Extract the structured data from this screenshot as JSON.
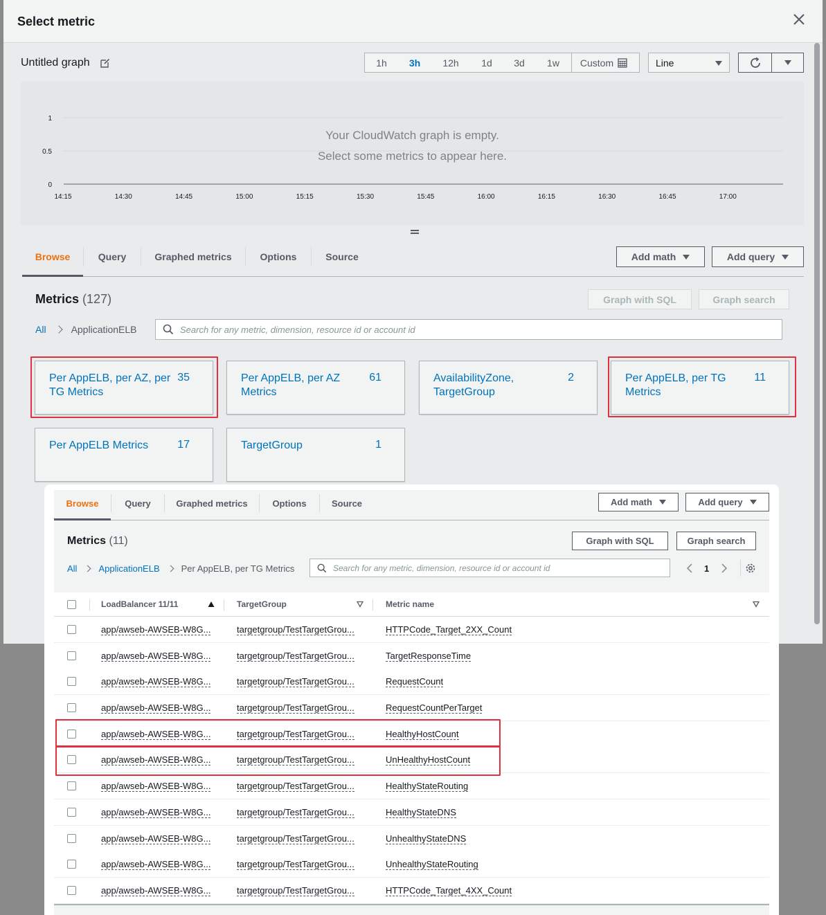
{
  "modal": {
    "title": "Select metric",
    "graph_title": "Untitled graph",
    "time_ranges": [
      "1h",
      "3h",
      "12h",
      "1d",
      "3d",
      "1w"
    ],
    "active_range": "3h",
    "custom_label": "Custom",
    "graph_type": "Line",
    "empty_line1": "Your CloudWatch graph is empty.",
    "empty_line2": "Select some metrics to appear here.",
    "y_ticks": [
      "1",
      "0.5",
      "0"
    ],
    "x_ticks": [
      "14:15",
      "14:30",
      "14:45",
      "15:00",
      "15:15",
      "15:30",
      "15:45",
      "16:00",
      "16:15",
      "16:30",
      "16:45",
      "17:00"
    ]
  },
  "tabs": [
    "Browse",
    "Query",
    "Graphed metrics",
    "Options",
    "Source"
  ],
  "buttons": {
    "add_math": "Add math",
    "add_query": "Add query",
    "graph_sql": "Graph with SQL",
    "graph_search": "Graph search"
  },
  "browse": {
    "heading": "Metrics",
    "count": "(127)",
    "crumb_all": "All",
    "crumb_current": "ApplicationELB",
    "search_placeholder": "Search for any metric, dimension, resource id or account id",
    "cards": [
      {
        "name": "Per AppELB, per AZ, per TG Metrics",
        "count": "35",
        "highlighted": true
      },
      {
        "name": "Per AppELB, per AZ Metrics",
        "count": "61",
        "highlighted": false
      },
      {
        "name": "AvailabilityZone, TargetGroup",
        "count": "2",
        "highlighted": false
      },
      {
        "name": "Per AppELB, per TG Metrics",
        "count": "11",
        "highlighted": true
      },
      {
        "name": "Per AppELB Metrics",
        "count": "17",
        "highlighted": false
      },
      {
        "name": "TargetGroup",
        "count": "1",
        "highlighted": false
      }
    ]
  },
  "detail": {
    "heading": "Metrics",
    "count": "(11)",
    "crumb_all": "All",
    "crumb_namespace": "ApplicationELB",
    "crumb_current": "Per AppELB, per TG Metrics",
    "search_placeholder": "Search for any metric, dimension, resource id or account id",
    "page": "1",
    "columns": [
      "LoadBalancer 11/11",
      "TargetGroup",
      "Metric name"
    ],
    "rows": [
      {
        "lb": "app/awseb-AWSEB-W8G...",
        "tg": "targetgroup/TestTargetGrou...",
        "metric": "HTTPCode_Target_2XX_Count"
      },
      {
        "lb": "app/awseb-AWSEB-W8G...",
        "tg": "targetgroup/TestTargetGrou...",
        "metric": "TargetResponseTime"
      },
      {
        "lb": "app/awseb-AWSEB-W8G...",
        "tg": "targetgroup/TestTargetGrou...",
        "metric": "RequestCount"
      },
      {
        "lb": "app/awseb-AWSEB-W8G...",
        "tg": "targetgroup/TestTargetGrou...",
        "metric": "RequestCountPerTarget"
      },
      {
        "lb": "app/awseb-AWSEB-W8G...",
        "tg": "targetgroup/TestTargetGrou...",
        "metric": "HealthyHostCount"
      },
      {
        "lb": "app/awseb-AWSEB-W8G...",
        "tg": "targetgroup/TestTargetGrou...",
        "metric": "UnHealthyHostCount"
      },
      {
        "lb": "app/awseb-AWSEB-W8G...",
        "tg": "targetgroup/TestTargetGrou...",
        "metric": "HealthyStateRouting"
      },
      {
        "lb": "app/awseb-AWSEB-W8G...",
        "tg": "targetgroup/TestTargetGrou...",
        "metric": "HealthyStateDNS"
      },
      {
        "lb": "app/awseb-AWSEB-W8G...",
        "tg": "targetgroup/TestTargetGrou...",
        "metric": "UnhealthyStateDNS"
      },
      {
        "lb": "app/awseb-AWSEB-W8G...",
        "tg": "targetgroup/TestTargetGrou...",
        "metric": "UnhealthyStateRouting"
      },
      {
        "lb": "app/awseb-AWSEB-W8G...",
        "tg": "targetgroup/TestTargetGrou...",
        "metric": "HTTPCode_Target_4XX_Count"
      }
    ]
  },
  "colors": {
    "accent": "#ec7211",
    "link": "#0073bb",
    "highlight": "#e0313f"
  },
  "icons": [
    "close-icon",
    "edit-icon",
    "calendar-icon",
    "refresh-icon",
    "chevron-down-icon",
    "search-icon",
    "chevron-left-icon",
    "chevron-right-icon",
    "gear-icon",
    "sort-asc-icon",
    "sort-icon"
  ]
}
